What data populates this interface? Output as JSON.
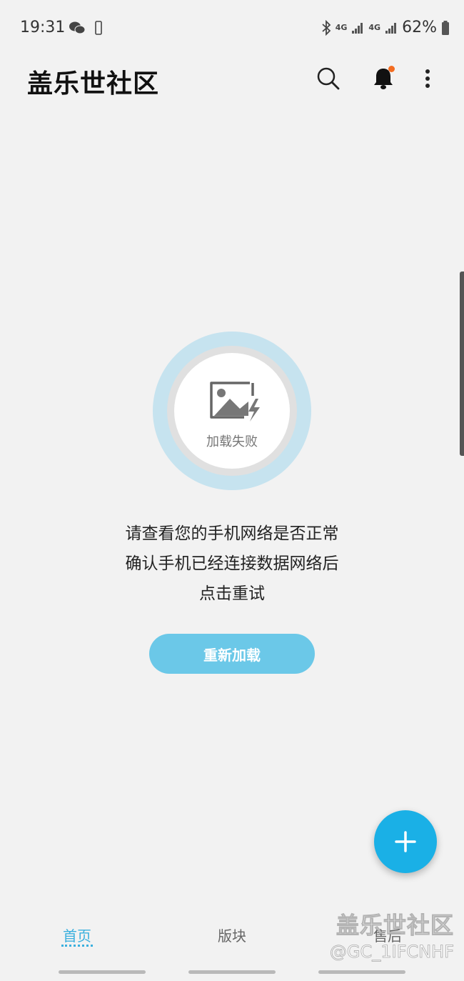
{
  "status_bar": {
    "time": "19:31",
    "battery": "62%",
    "network_label_1": "4G",
    "network_label_2": "4G"
  },
  "app_bar": {
    "title": "盖乐世社区",
    "icons": [
      "search-icon",
      "bell-icon",
      "more-vertical-icon"
    ],
    "notification_dot_color": "#f36c21"
  },
  "error_state": {
    "image_label": "加载失败",
    "message_lines": [
      "请查看您的手机网络是否正常",
      "确认手机已经连接数据网络后",
      "点击重试"
    ],
    "reload_button": "重新加载"
  },
  "fab": {
    "icon": "plus-icon",
    "color": "#1ab0e6"
  },
  "bottom_nav": {
    "items": [
      {
        "label": "首页",
        "active": true
      },
      {
        "label": "版块",
        "active": false
      },
      {
        "label": "售后",
        "active": false
      }
    ],
    "active_color": "#3bb0de"
  },
  "watermark": {
    "title": "盖乐世社区",
    "user": "@GC_1IFCNHF"
  }
}
